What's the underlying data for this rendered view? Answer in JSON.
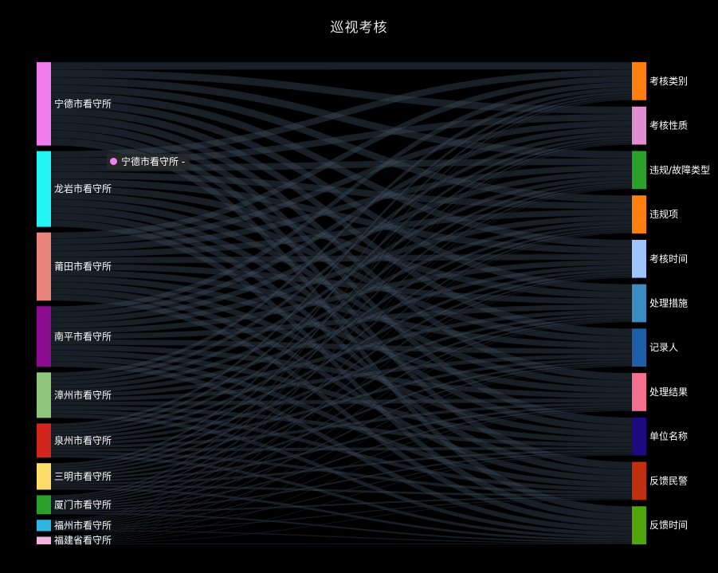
{
  "title": "巡视考核",
  "tooltip": {
    "text": "宁德市看守所 -",
    "color": "#ee82ee"
  },
  "chart_data": {
    "type": "sankey",
    "title": "巡视考核",
    "link_color": "#3b4a5a",
    "left_nodes": [
      {
        "name": "宁德市看守所",
        "color": "#f07cf0",
        "weight": 11
      },
      {
        "name": "龙岩市看守所",
        "color": "#22f3f3",
        "weight": 10
      },
      {
        "name": "莆田市看守所",
        "color": "#e8847c",
        "weight": 9
      },
      {
        "name": "南平市看守所",
        "color": "#8b0c90",
        "weight": 8
      },
      {
        "name": "漳州市看守所",
        "color": "#8ec77b",
        "weight": 6
      },
      {
        "name": "泉州市看守所",
        "color": "#d2261c",
        "weight": 4.5
      },
      {
        "name": "三明市看守所",
        "color": "#fddc6a",
        "weight": 3.5
      },
      {
        "name": "厦门市看守所",
        "color": "#2aa02a",
        "weight": 2.5
      },
      {
        "name": "福州市看守所",
        "color": "#2eb5e1",
        "weight": 1.5
      },
      {
        "name": "福建省看守所",
        "color": "#f3b5e0",
        "weight": 1
      }
    ],
    "right_nodes": [
      {
        "name": "考核类别",
        "color": "#ff7f0e"
      },
      {
        "name": "考核性质",
        "color": "#e08ed0"
      },
      {
        "name": "违规/故障类型",
        "color": "#2ca02c"
      },
      {
        "name": "违规项",
        "color": "#ff7f0e"
      },
      {
        "name": "考核时间",
        "color": "#9ec4fb"
      },
      {
        "name": "处理措施",
        "color": "#3b8cc0"
      },
      {
        "name": "记录人",
        "color": "#1f5fa8"
      },
      {
        "name": "处理结果",
        "color": "#f5708e"
      },
      {
        "name": "单位名称",
        "color": "#1e0a80"
      },
      {
        "name": "反馈民警",
        "color": "#c1300e"
      },
      {
        "name": "反馈时间",
        "color": "#52a40b"
      }
    ]
  }
}
